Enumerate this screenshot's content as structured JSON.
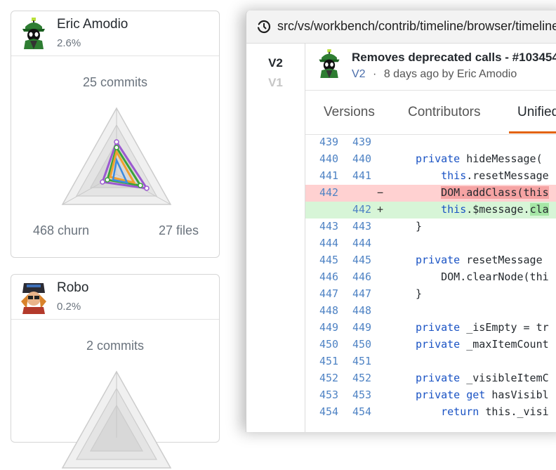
{
  "contributors": [
    {
      "name": "Eric Amodio",
      "percent": "2.6%",
      "commits": "25 commits",
      "churn": "468 churn",
      "files": "27 files",
      "avatar_icon": "martian-avatar-icon"
    },
    {
      "name": "Robo",
      "percent": "0.2%",
      "commits": "2 commits",
      "avatar_icon": "robot-avatar-icon"
    }
  ],
  "radar_colors": {
    "purple": "#9b59d0",
    "green": "#3aa33a",
    "orange": "#f0a030",
    "blue": "#3a8be0",
    "grid": "#cccccc",
    "fill": "#f0f0f0"
  },
  "window": {
    "title": "src/vs/workbench/contrib/timeline/browser/timeline",
    "title_icon": "timeline-history-icon"
  },
  "versions": [
    "V2",
    "V1"
  ],
  "commit": {
    "title": "Removes deprecated calls - #103454",
    "version": "V2",
    "separator": "·",
    "meta": "8 days ago by Eric Amodio"
  },
  "tabs": [
    "Versions",
    "Contributors",
    "Unified"
  ],
  "colors": {
    "accent": "#e36209",
    "deleted_line_bg": "#ffd1d1",
    "added_line_bg": "#d7f5d7",
    "line_number": "#4f83c4"
  },
  "diff_lines": [
    {
      "old": "439",
      "new": "439",
      "marker": "",
      "type": "context",
      "code": ""
    },
    {
      "old": "440",
      "new": "440",
      "marker": "",
      "type": "context",
      "code": "private hideMessage("
    },
    {
      "old": "441",
      "new": "441",
      "marker": "",
      "type": "context",
      "code": "    this.resetMessage"
    },
    {
      "old": "442",
      "new": "",
      "marker": "−",
      "type": "del",
      "code": "    DOM.addClass(this"
    },
    {
      "old": "",
      "new": "442",
      "marker": "+",
      "type": "add",
      "code": "    this.$message.cla"
    },
    {
      "old": "443",
      "new": "443",
      "marker": "",
      "type": "context",
      "code": "}"
    },
    {
      "old": "444",
      "new": "444",
      "marker": "",
      "type": "context",
      "code": ""
    },
    {
      "old": "445",
      "new": "445",
      "marker": "",
      "type": "context",
      "code": "private resetMessage"
    },
    {
      "old": "446",
      "new": "446",
      "marker": "",
      "type": "context",
      "code": "    DOM.clearNode(thi"
    },
    {
      "old": "447",
      "new": "447",
      "marker": "",
      "type": "context",
      "code": "}"
    },
    {
      "old": "448",
      "new": "448",
      "marker": "",
      "type": "context",
      "code": ""
    },
    {
      "old": "449",
      "new": "449",
      "marker": "",
      "type": "context",
      "code": "private _isEmpty = tr"
    },
    {
      "old": "450",
      "new": "450",
      "marker": "",
      "type": "context",
      "code": "private _maxItemCount"
    },
    {
      "old": "451",
      "new": "451",
      "marker": "",
      "type": "context",
      "code": ""
    },
    {
      "old": "452",
      "new": "452",
      "marker": "",
      "type": "context",
      "code": "private _visibleItemC"
    },
    {
      "old": "453",
      "new": "453",
      "marker": "",
      "type": "context",
      "code": "private get hasVisibl"
    },
    {
      "old": "454",
      "new": "454",
      "marker": "",
      "type": "context",
      "code": "    return this._visi"
    }
  ]
}
